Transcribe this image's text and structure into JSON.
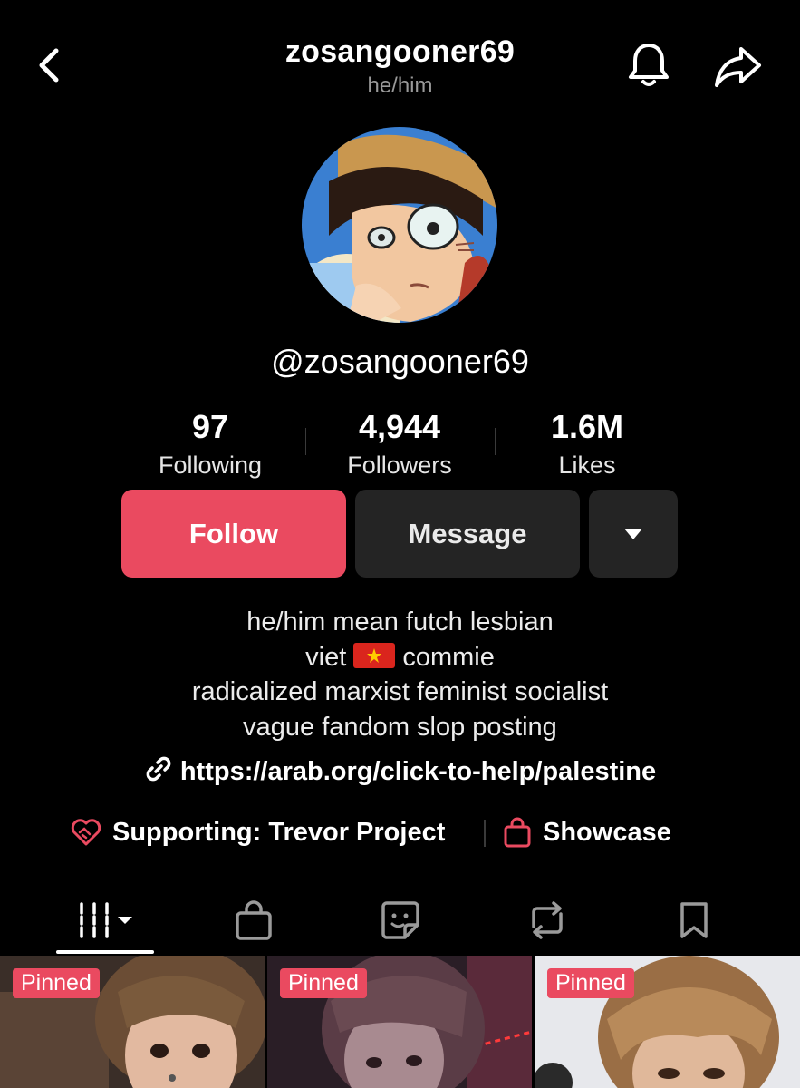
{
  "header": {
    "username": "zosangooner69",
    "pronouns": "he/him",
    "back_icon": "chevron-left-icon",
    "bell_icon": "bell-icon",
    "share_icon": "share-arrow-icon"
  },
  "profile": {
    "handle": "@zosangooner69",
    "avatar": "anime-avatar"
  },
  "stats": {
    "following": {
      "value": "97",
      "label": "Following"
    },
    "followers": {
      "value": "4,944",
      "label": "Followers"
    },
    "likes": {
      "value": "1.6M",
      "label": "Likes"
    }
  },
  "actions": {
    "follow_label": "Follow",
    "message_label": "Message",
    "more_icon": "caret-down-icon"
  },
  "bio": {
    "line1": "he/him mean futch lesbian",
    "line2_pre": "viet",
    "line2_post": "commie",
    "line3": "radicalized marxist feminist socialist",
    "line4": "vague fandom slop posting"
  },
  "link": {
    "url": "https://arab.org/click-to-help/palestine"
  },
  "extras": {
    "supporting_label": "Supporting: Trevor Project",
    "showcase_label": "Showcase"
  },
  "tabs": [
    {
      "icon": "videos-grid-icon",
      "active": true
    },
    {
      "icon": "shopping-bag-icon",
      "active": false
    },
    {
      "icon": "sticker-icon",
      "active": false
    },
    {
      "icon": "repost-icon",
      "active": false
    },
    {
      "icon": "bookmark-icon",
      "active": false
    }
  ],
  "videos": [
    {
      "badge": "Pinned"
    },
    {
      "badge": "Pinned"
    },
    {
      "badge": "Pinned"
    }
  ],
  "colors": {
    "accent": "#ea4a60",
    "button_dark": "#242424",
    "background": "#000000",
    "secondary_text": "#9a9a9a"
  }
}
